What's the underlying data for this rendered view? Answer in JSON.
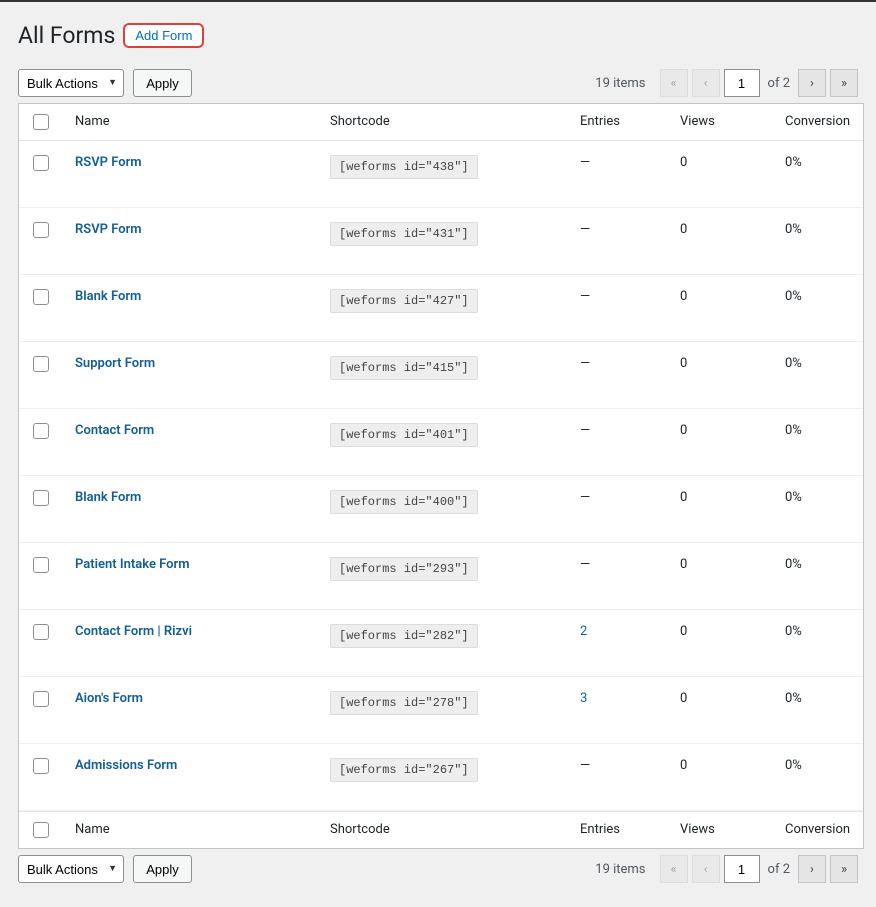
{
  "header": {
    "title": "All Forms",
    "add_button": "Add Form"
  },
  "bulk": {
    "select_label": "Bulk Actions",
    "apply_label": "Apply"
  },
  "pagination": {
    "items_text": "19 items",
    "first": "«",
    "prev": "‹",
    "current_page": "1",
    "total_text": "of 2",
    "next": "›",
    "last": "»"
  },
  "columns": {
    "name": "Name",
    "shortcode": "Shortcode",
    "entries": "Entries",
    "views": "Views",
    "conversion": "Conversion"
  },
  "rows": [
    {
      "name": "RSVP Form",
      "shortcode": "[weforms id=\"438\"]",
      "entries": "—",
      "entries_link": false,
      "views": "0",
      "conversion": "0%"
    },
    {
      "name": "RSVP Form",
      "shortcode": "[weforms id=\"431\"]",
      "entries": "—",
      "entries_link": false,
      "views": "0",
      "conversion": "0%"
    },
    {
      "name": "Blank Form",
      "shortcode": "[weforms id=\"427\"]",
      "entries": "—",
      "entries_link": false,
      "views": "0",
      "conversion": "0%"
    },
    {
      "name": "Support Form",
      "shortcode": "[weforms id=\"415\"]",
      "entries": "—",
      "entries_link": false,
      "views": "0",
      "conversion": "0%"
    },
    {
      "name": "Contact Form",
      "shortcode": "[weforms id=\"401\"]",
      "entries": "—",
      "entries_link": false,
      "views": "0",
      "conversion": "0%"
    },
    {
      "name": "Blank Form",
      "shortcode": "[weforms id=\"400\"]",
      "entries": "—",
      "entries_link": false,
      "views": "0",
      "conversion": "0%"
    },
    {
      "name": "Patient Intake Form",
      "shortcode": "[weforms id=\"293\"]",
      "entries": "—",
      "entries_link": false,
      "views": "0",
      "conversion": "0%"
    },
    {
      "name": "Contact Form | Rizvi",
      "shortcode": "[weforms id=\"282\"]",
      "entries": "2",
      "entries_link": true,
      "views": "0",
      "conversion": "0%"
    },
    {
      "name": "Aion's Form",
      "shortcode": "[weforms id=\"278\"]",
      "entries": "3",
      "entries_link": true,
      "views": "0",
      "conversion": "0%"
    },
    {
      "name": "Admissions Form",
      "shortcode": "[weforms id=\"267\"]",
      "entries": "—",
      "entries_link": false,
      "views": "0",
      "conversion": "0%"
    }
  ]
}
